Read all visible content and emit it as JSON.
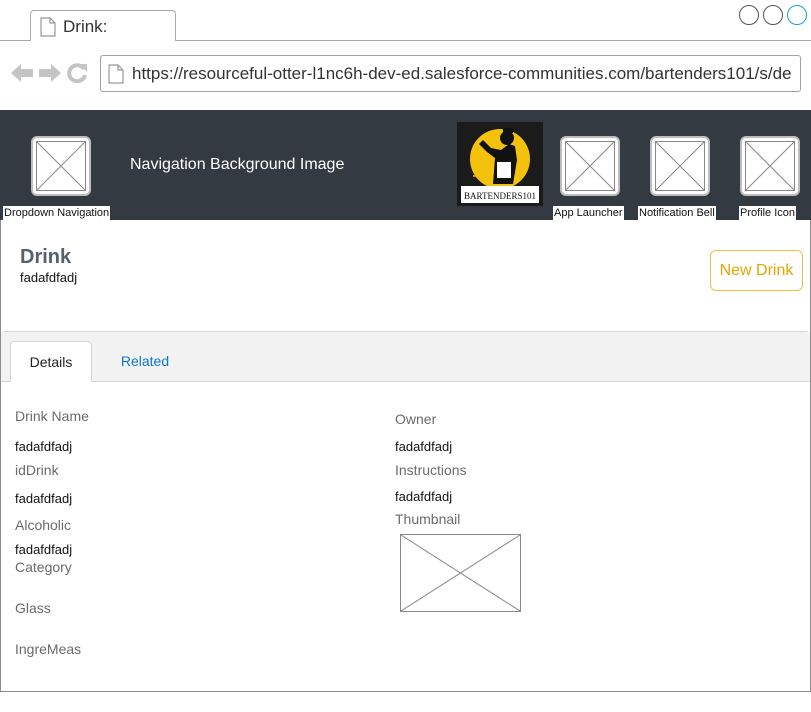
{
  "browser": {
    "tab_title": "Drink:",
    "url": "https://resourceful-otter-l1nc6h-dev-ed.salesforce-communities.com/bartenders101/s/de"
  },
  "nav": {
    "dropdown_caption": "Dropdown Navigation",
    "background_text": "Navigation Background Image",
    "logo_text": "BARTENDERS101",
    "app_launcher_caption": "App Launcher",
    "notification_caption": "Notification Bell",
    "profile_caption": "Profile Icon"
  },
  "record": {
    "title": "Drink",
    "subtitle": "fadafdfadj",
    "new_button": "New Drink"
  },
  "tabs": {
    "details": "Details",
    "related": "Related"
  },
  "fields": {
    "drink_name": {
      "label": "Drink Name",
      "value": "fadafdfadj"
    },
    "id_drink": {
      "label": "idDrink",
      "value": "fadafdfadj"
    },
    "alcoholic": {
      "label": "Alcoholic",
      "value": "fadafdfadj"
    },
    "category": {
      "label": "Category"
    },
    "glass": {
      "label": "Glass"
    },
    "ingre_meas": {
      "label": "IngreMeas"
    },
    "owner": {
      "label": "Owner",
      "value": "fadafdfadj"
    },
    "instructions": {
      "label": "Instructions",
      "value": "fadafdfadj"
    },
    "thumbnail": {
      "label": "Thumbnail"
    }
  }
}
